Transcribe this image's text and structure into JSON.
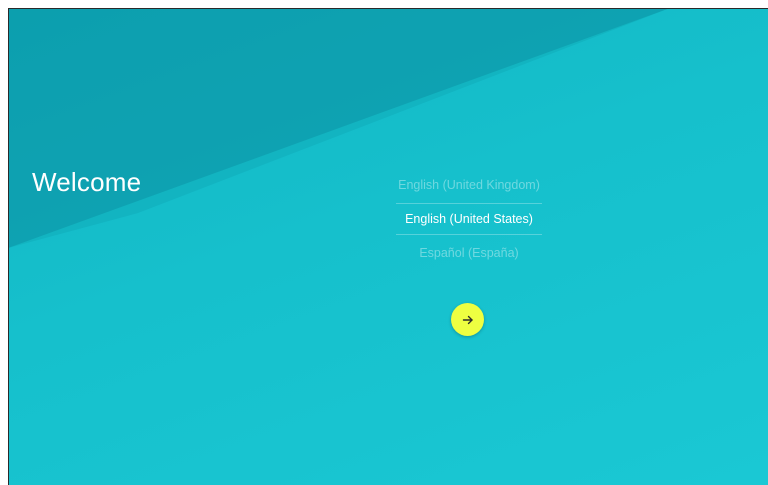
{
  "screen": {
    "title": "Welcome"
  },
  "languages": {
    "items": [
      {
        "label": "English (United Kingdom)",
        "selected": false
      },
      {
        "label": "English (United States)",
        "selected": true
      },
      {
        "label": "Español (España)",
        "selected": false
      }
    ]
  },
  "next_button": {
    "icon": "arrow-right-icon"
  },
  "colors": {
    "background": "#16c0cc",
    "background_dark_shard": "#0a8fa0",
    "accent_button": "#eeff41",
    "text_primary": "#ffffff"
  }
}
